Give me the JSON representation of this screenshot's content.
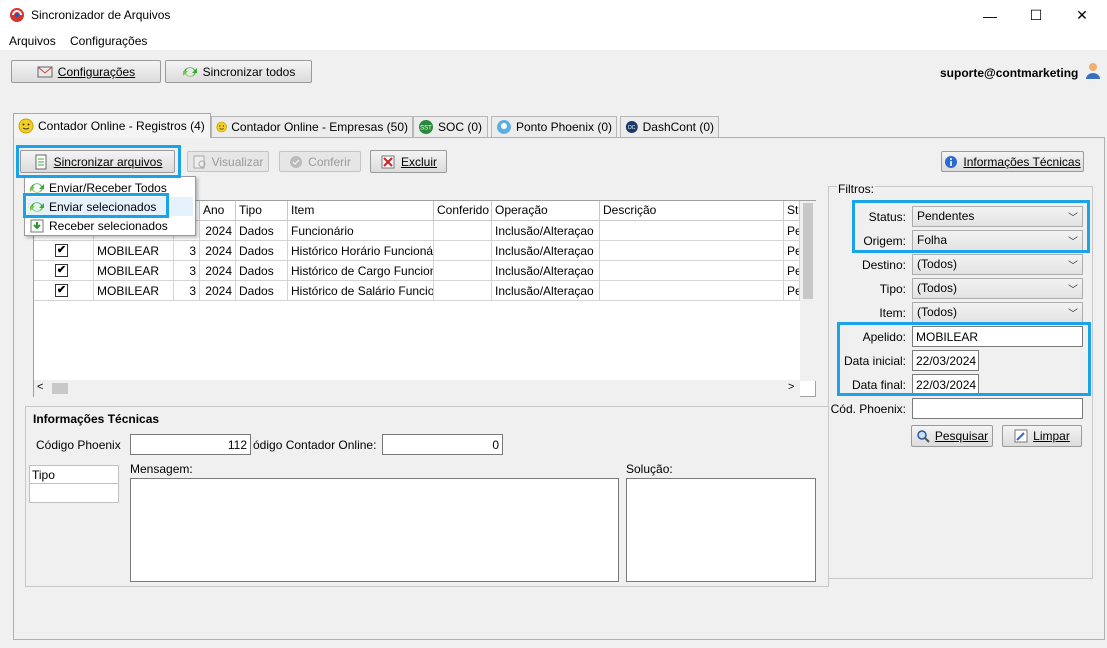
{
  "window": {
    "title": "Sincronizador de Arquivos",
    "minimize": "—",
    "maximize": "☐",
    "close": "✕"
  },
  "menu": {
    "arquivos": "Arquivos",
    "configuracoes": "Configurações"
  },
  "toolbar": {
    "config_label": "Configurações",
    "sync_all_label": "Sincronizar todos",
    "user": "suporte@contmarketing"
  },
  "tabs": [
    {
      "label": "Contador Online - Registros (4)"
    },
    {
      "label": "Contador Online - Empresas (50)"
    },
    {
      "label": "SOC (0)"
    },
    {
      "label": "Ponto Phoenix (0)"
    },
    {
      "label": "DashCont (0)"
    }
  ],
  "actions": {
    "sync_files": "Sincronizar arquivos",
    "visualizar": "Visualizar",
    "conferir": "Conferir",
    "excluir": "Excluir",
    "info_tecnicas": "Informações Técnicas"
  },
  "dropdown": {
    "item1": "Enviar/Receber Todos",
    "item2": "Enviar selecionados",
    "item3": "Receber selecionados"
  },
  "grid": {
    "columns": [
      "Ano",
      "Tipo",
      "Item",
      "Conferido",
      "Operação",
      "Descrição",
      "Sta"
    ],
    "rows": [
      {
        "checked": "",
        "apelido": "",
        "n": "",
        "ano": "2024",
        "tipo": "Dados",
        "item": "Funcionário",
        "conferido": "",
        "operacao": "Inclusão/Alteraçao",
        "descricao": "",
        "status": "Pen"
      },
      {
        "checked": "✔",
        "apelido": "MOBILEAR",
        "n": "3",
        "ano": "2024",
        "tipo": "Dados",
        "item": "Histórico Horário Funcionári",
        "conferido": "",
        "operacao": "Inclusão/Alteraçao",
        "descricao": "",
        "status": "Pen"
      },
      {
        "checked": "✔",
        "apelido": "MOBILEAR",
        "n": "3",
        "ano": "2024",
        "tipo": "Dados",
        "item": "Histórico de Cargo Funcion",
        "conferido": "",
        "operacao": "Inclusão/Alteraçao",
        "descricao": "",
        "status": "Pen"
      },
      {
        "checked": "✔",
        "apelido": "MOBILEAR",
        "n": "3",
        "ano": "2024",
        "tipo": "Dados",
        "item": "Histórico de Salário Funcior",
        "conferido": "",
        "operacao": "Inclusão/Alteraçao",
        "descricao": "",
        "status": "Pen"
      }
    ]
  },
  "info": {
    "title": "Informações Técnicas",
    "codigo_phoenix_label": "Código Phoenix",
    "codigo_phoenix_value": "112",
    "codigo_co_label": "ódigo Contador Online:",
    "codigo_co_value": "0",
    "tipo_label": "Tipo",
    "mensagem_label": "Mensagem:",
    "solucao_label": "Solução:"
  },
  "filters": {
    "title": "Filtros:",
    "status_label": "Status:",
    "status_value": "Pendentes",
    "origem_label": "Origem:",
    "origem_value": "Folha",
    "destino_label": "Destino:",
    "destino_value": "(Todos)",
    "tipo_label": "Tipo:",
    "tipo_value": "(Todos)",
    "item_label": "Item:",
    "item_value": "(Todos)",
    "apelido_label": "Apelido:",
    "apelido_value": "MOBILEAR",
    "data_inicial_label": "Data inicial:",
    "data_inicial_value": "22/03/2024",
    "data_final_label": "Data final:",
    "data_final_value": "22/03/2024",
    "cod_phoenix_label": "Cód. Phoenix:",
    "cod_phoenix_value": "",
    "pesquisar": "Pesquisar",
    "limpar": "Limpar"
  },
  "colors": {
    "highlight": "#1aa3e8"
  }
}
